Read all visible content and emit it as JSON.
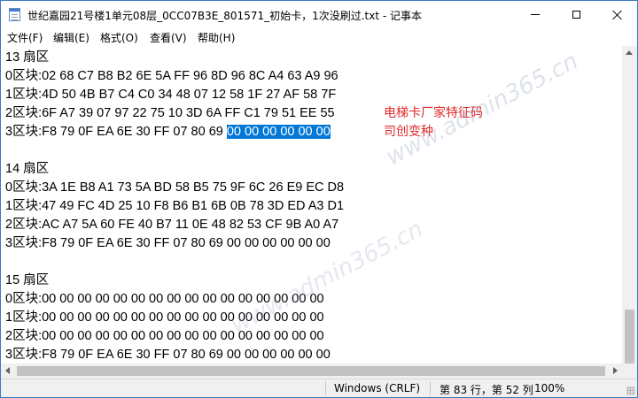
{
  "window": {
    "title": "世纪嘉园21号楼1单元08层_0CC07B3E_801571_初始卡，1次没刷过.txt - 记事本"
  },
  "menu": [
    {
      "label": "文件(F)"
    },
    {
      "label": "编辑(E)"
    },
    {
      "label": "格式(O)"
    },
    {
      "label": "查看(V)"
    },
    {
      "label": "帮助(H)"
    }
  ],
  "editor": {
    "lines": [
      {
        "text": "13 扇区"
      },
      {
        "text": "0区块:02 68 C7 B8 B2 6E 5A FF 96 8D 96 8C A4 63 A9 96"
      },
      {
        "text": "1区块:4D 50 4B B7 C4 C0 34 48 07 12 58 1F 27 AF 58 7F"
      },
      {
        "text": "2区块:6F A7 39 07 97 22 75 10 3D 6A FF C1 79 51 EE 55"
      },
      {
        "text": "3区块:F8 79 0F EA 6E 30 FF 07 80 69",
        "selected": "00 00 00 00 00 00"
      },
      {
        "text": ""
      },
      {
        "text": "14 扇区"
      },
      {
        "text": "0区块:3A 1E B8 A1 73 5A BD 58 B5 75 9F 6C 26 E9 EC D8"
      },
      {
        "text": "1区块:47 49 FC 4D 25 10 F8 B6 B1 6B 0B 78 3D ED A3 D1"
      },
      {
        "text": "2区块:AC A7 5A 60 FE 40 B7 11 0E 48 82 53 CF 9B A0 A7"
      },
      {
        "text": "3区块:F8 79 0F EA 6E 30 FF 07 80 69 00 00 00 00 00 00"
      },
      {
        "text": ""
      },
      {
        "text": "15 扇区"
      },
      {
        "text": "0区块:00 00 00 00 00 00 00 00 00 00 00 00 00 00 00 00"
      },
      {
        "text": "1区块:00 00 00 00 00 00 00 00 00 00 00 00 00 00 00 00"
      },
      {
        "text": "2区块:00 00 00 00 00 00 00 00 00 00 00 00 00 00 00 00"
      },
      {
        "text": "3区块:F8 79 0F EA 6E 30 FF 07 80 69 00 00 00 00 00 00"
      }
    ],
    "annotation": [
      "电梯卡厂家特征码",
      "司创变种"
    ],
    "watermark": "www.admin365.cn"
  },
  "status": {
    "encoding": "Windows (CRLF)",
    "position": "第 83 行，第 52 列",
    "zoom": "100%"
  },
  "colors": {
    "selection": "#0078d7",
    "annotation": "#e0282a",
    "window_border": "#3c78c0"
  }
}
